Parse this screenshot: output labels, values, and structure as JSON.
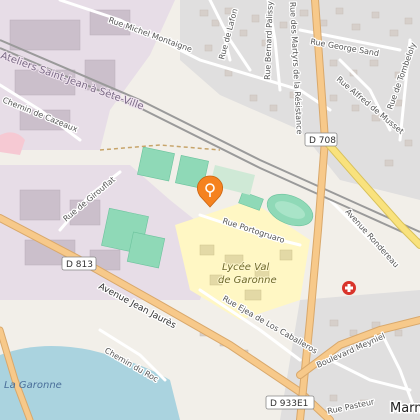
{
  "map": {
    "colors": {
      "background": "#f2efe9",
      "industrial": "#e7dde7",
      "residential": "#e0dfdf",
      "school": "#fff7c4",
      "sports": "#8fd9b7",
      "water": "#aad3df",
      "primary_road": "#f7c98a",
      "trunk_road": "#f9e27d",
      "marker": "#f58220"
    },
    "streets": {
      "rue_michel_montaigne": "Rue Michel Montaigne",
      "rue_de_lafon": "Rue de Lafon",
      "rue_bernard_palissy": "Rue Bernard Palissy",
      "rue_des_martyrs": "Rue des Martyrs de la Résistance",
      "rue_george_sand": "Rue George Sand",
      "rue_alfred_de_musset": "Rue Alfred de Musset",
      "rue_de_tombeloly": "Rue de Tombeloly",
      "chemin_de_cazeaux": "Chemin de Cazeaux",
      "rue_de_girouflat": "Rue de Girouflat",
      "rue_portogruaro": "Rue Portogruaro",
      "avenue_rondereau": "Avenue Rondereau",
      "avenue_jean_jaures": "Avenue Jean Jaurès",
      "rue_ejea": "Rue Ejea de Los Caballeros",
      "boulevard_meyniel": "Boulevard Meyniel",
      "chemin_du_roc": "Chemin du Roc",
      "rue_pasteur": "Rue Pasteur"
    },
    "district_label": "Ateliers Saint-Jean à Sète-Ville",
    "school_label_line1": "Lycée Val",
    "school_label_line2": "de Garonne",
    "river_label": "La Garonne",
    "town_label": "Marm",
    "route_shields": {
      "d708": "D 708",
      "d813": "D 813",
      "d933e1": "D 933E1"
    },
    "icons": {
      "location_marker": "location-pin-icon",
      "hospital": "hospital-cross-icon"
    }
  }
}
